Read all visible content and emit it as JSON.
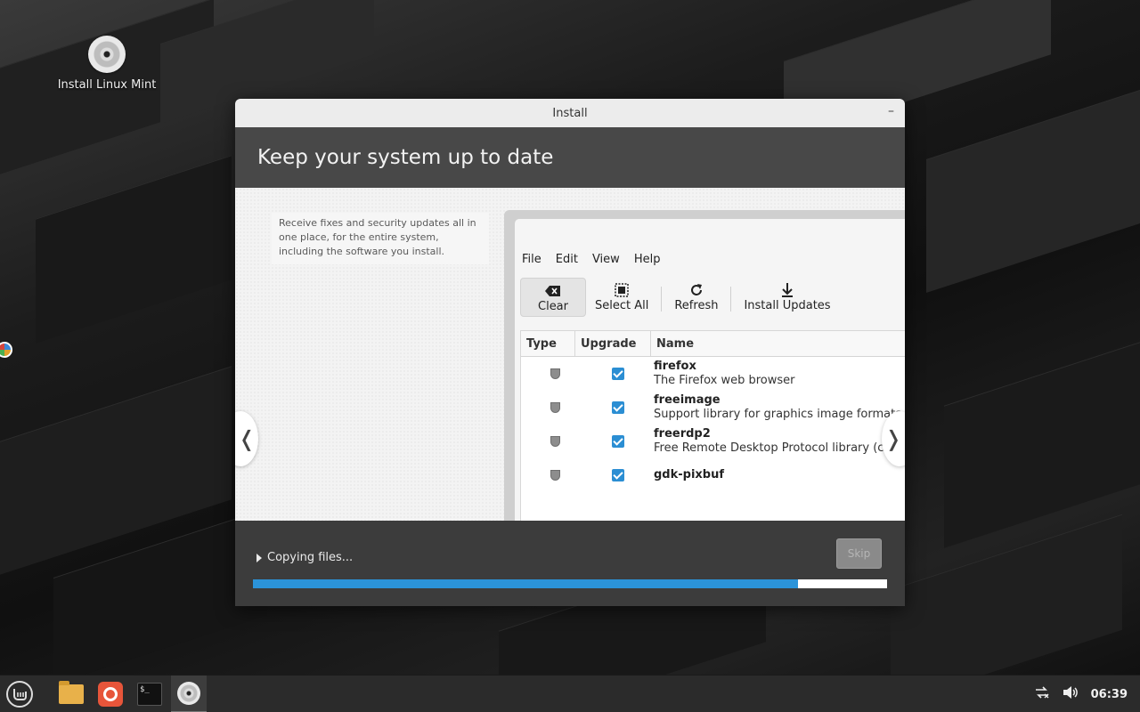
{
  "desktop": {
    "icon_label": "Install Linux Mint"
  },
  "window": {
    "title": "Install",
    "minimize_label": "–",
    "heading": "Keep your system up to date",
    "caption": "Receive fixes and security updates all in one place, for the entire system, including the software you install.",
    "nav_prev": "❬",
    "nav_next": "❭"
  },
  "preview": {
    "menu": [
      "File",
      "Edit",
      "View",
      "Help"
    ],
    "toolbar": {
      "clear": "Clear",
      "select_all": "Select All",
      "refresh": "Refresh",
      "install_updates": "Install Updates"
    },
    "columns": [
      "Type",
      "Upgrade",
      "Name"
    ],
    "packages": [
      {
        "name": "firefox",
        "desc": "The Firefox web browser"
      },
      {
        "name": "freeimage",
        "desc": "Support library for graphics image formats (libr"
      },
      {
        "name": "freerdp2",
        "desc": "Free Remote Desktop Protocol library (core libr"
      },
      {
        "name": "gdk-pixbuf",
        "desc": ""
      }
    ]
  },
  "footer": {
    "status": "Copying files...",
    "skip_label": "Skip",
    "progress_fraction": 0.86
  },
  "taskbar": {
    "time": "06:39"
  },
  "colors": {
    "accent": "#2b93d9",
    "header_bg": "#484848",
    "footer_bg": "#3c3c3c"
  }
}
